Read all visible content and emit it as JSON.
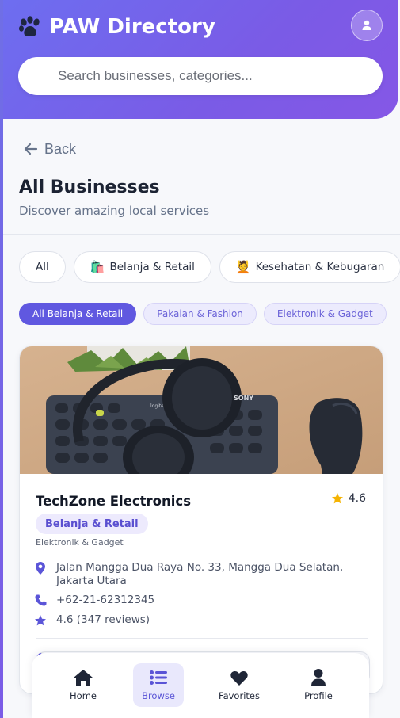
{
  "header": {
    "brand": "PAW Directory",
    "brand_icon": "paw-icon",
    "profile_icon": "user-icon",
    "colors": {
      "gradient_start": "#6d6ef0",
      "gradient_end": "#8557e6"
    }
  },
  "search": {
    "placeholder": "Search businesses, categories...",
    "value": ""
  },
  "back_label": "Back",
  "page": {
    "title": "All Businesses",
    "subtitle": "Discover amazing local services"
  },
  "categories": [
    {
      "emoji": "",
      "label": "All"
    },
    {
      "emoji": "🛍️",
      "label": "Belanja & Retail"
    },
    {
      "emoji": "💆",
      "label": "Kesehatan & Kebugaran"
    }
  ],
  "subcategories": [
    {
      "label": "All Belanja & Retail",
      "active": true
    },
    {
      "label": "Pakaian & Fashion",
      "active": false
    },
    {
      "label": "Elektronik & Gadget",
      "active": false
    }
  ],
  "business": {
    "name": "TechZone Electronics",
    "rating": "4.6",
    "category": "Belanja & Retail",
    "subcategory": "Elektronik & Gadget",
    "address": "Jalan Mangga Dua Raya No. 33, Mangga Dua Selatan, Jakarta Utara",
    "phone": "+62-21-62312345",
    "reviews": "4.6 (347 reviews)",
    "image_brands": {
      "headphones": "SONY",
      "keyboard": "logitech"
    }
  },
  "nav": {
    "items": [
      {
        "label": "Home",
        "icon": "home-icon",
        "active": false
      },
      {
        "label": "Browse",
        "icon": "list-icon",
        "active": true
      },
      {
        "label": "Favorites",
        "icon": "heart-icon",
        "active": false
      },
      {
        "label": "Profile",
        "icon": "user-icon",
        "active": false
      }
    ]
  },
  "colors": {
    "accent": "#6058e0",
    "accent_light": "#ecebfd",
    "star": "#f5b301"
  }
}
